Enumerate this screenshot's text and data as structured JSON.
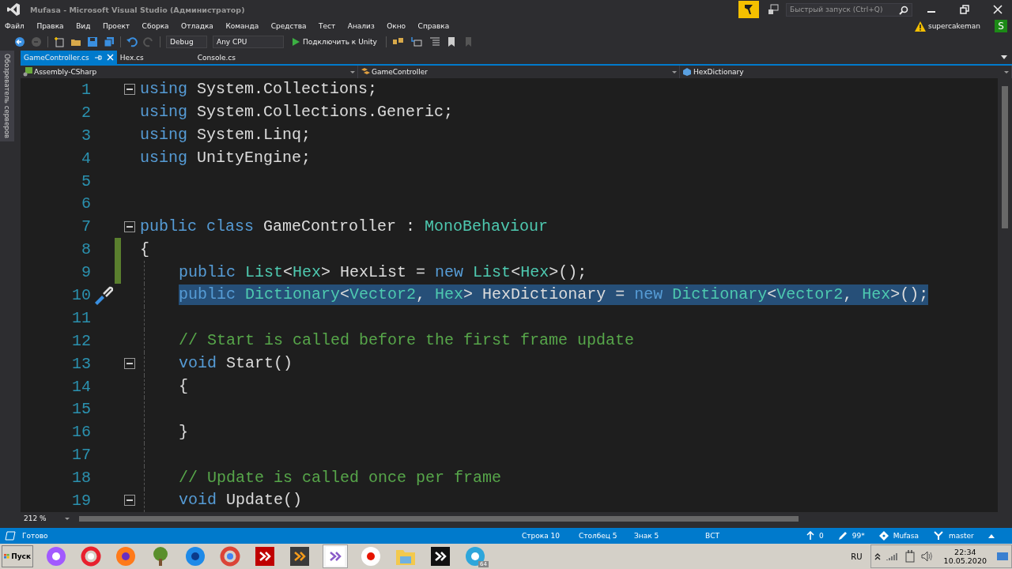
{
  "window": {
    "title": "Mufasa - Microsoft Visual Studio (Администратор)",
    "quick_launch": {
      "placeholder": "Быстрый запуск (Ctrl+Q)"
    },
    "user": "supercakeman",
    "avatar": "S"
  },
  "menu": [
    "Файл",
    "Правка",
    "Вид",
    "Проект",
    "Сборка",
    "Отладка",
    "Команда",
    "Средства",
    "Тест",
    "Анализ",
    "Окно",
    "Справка"
  ],
  "toolbar": {
    "configuration": "Debug",
    "platform": "Any CPU",
    "run_label": "Подключить к Unity"
  },
  "side_tab": "Обозреватель серверов",
  "tabs": [
    {
      "label": "GameController.cs",
      "selected": true
    },
    {
      "label": "Hex.cs",
      "selected": false
    },
    {
      "label": "Console.cs",
      "selected": false
    }
  ],
  "navigation": {
    "project": "Assembly-CSharp",
    "type": "GameController",
    "member": "HexDictionary"
  },
  "editor": {
    "zoom": "212 %",
    "lines": [
      {
        "number": "1",
        "fold": true,
        "indented": false,
        "changed": false,
        "selected": false,
        "quick_action": false,
        "tokens": [
          {
            "kind": "kw",
            "text": "using"
          },
          {
            "kind": "plain",
            "text": " System.Collections;"
          }
        ]
      },
      {
        "number": "2",
        "fold": false,
        "indented": false,
        "changed": false,
        "selected": false,
        "quick_action": false,
        "tokens": [
          {
            "kind": "kw",
            "text": "using"
          },
          {
            "kind": "plain",
            "text": " System.Collections.Generic;"
          }
        ]
      },
      {
        "number": "3",
        "fold": false,
        "indented": false,
        "changed": false,
        "selected": false,
        "quick_action": false,
        "tokens": [
          {
            "kind": "kw",
            "text": "using"
          },
          {
            "kind": "plain",
            "text": " System.Linq;"
          }
        ]
      },
      {
        "number": "4",
        "fold": false,
        "indented": false,
        "changed": false,
        "selected": false,
        "quick_action": false,
        "tokens": [
          {
            "kind": "kw",
            "text": "using"
          },
          {
            "kind": "plain",
            "text": " UnityEngine;"
          }
        ]
      },
      {
        "number": "5",
        "fold": false,
        "indented": false,
        "changed": false,
        "selected": false,
        "quick_action": false
      },
      {
        "number": "6",
        "fold": false,
        "indented": false,
        "changed": false,
        "selected": false,
        "quick_action": false
      },
      {
        "number": "7",
        "fold": true,
        "indented": false,
        "changed": false,
        "selected": false,
        "quick_action": false,
        "tokens": [
          {
            "kind": "kw",
            "text": "public class"
          },
          {
            "kind": "plain",
            "text": " GameController : "
          },
          {
            "kind": "type",
            "text": "MonoBehaviour"
          }
        ]
      },
      {
        "number": "8",
        "fold": false,
        "indented": false,
        "changed": true,
        "selected": false,
        "quick_action": false,
        "tokens": [
          {
            "kind": "plain",
            "text": "{"
          }
        ]
      },
      {
        "number": "9",
        "fold": false,
        "indented": true,
        "changed": true,
        "selected": false,
        "quick_action": false,
        "tokens": [
          {
            "kind": "kw",
            "text": "public "
          },
          {
            "kind": "type",
            "text": "List"
          },
          {
            "kind": "plain",
            "text": "<"
          },
          {
            "kind": "type",
            "text": "Hex"
          },
          {
            "kind": "plain",
            "text": "> HexList = "
          },
          {
            "kind": "kw",
            "text": "new "
          },
          {
            "kind": "type",
            "text": "List"
          },
          {
            "kind": "plain",
            "text": "<"
          },
          {
            "kind": "type",
            "text": "Hex"
          },
          {
            "kind": "plain",
            "text": ">();"
          }
        ]
      },
      {
        "number": "10",
        "fold": false,
        "indented": true,
        "changed": false,
        "selected": true,
        "quick_action": true,
        "tokens": [
          {
            "kind": "kw",
            "text": "public "
          },
          {
            "kind": "type",
            "text": "Dictionary"
          },
          {
            "kind": "plain",
            "text": "<"
          },
          {
            "kind": "type",
            "text": "Vector2"
          },
          {
            "kind": "plain",
            "text": ", "
          },
          {
            "kind": "type",
            "text": "Hex"
          },
          {
            "kind": "plain",
            "text": "> HexDictionary = "
          },
          {
            "kind": "kw",
            "text": "new "
          },
          {
            "kind": "type",
            "text": "Dictionary"
          },
          {
            "kind": "plain",
            "text": "<"
          },
          {
            "kind": "type",
            "text": "Vector2"
          },
          {
            "kind": "plain",
            "text": ", "
          },
          {
            "kind": "type",
            "text": "Hex"
          },
          {
            "kind": "plain",
            "text": ">();"
          }
        ]
      },
      {
        "number": "11",
        "fold": false,
        "indented": true,
        "changed": false,
        "selected": false,
        "quick_action": false
      },
      {
        "number": "12",
        "fold": false,
        "indented": true,
        "changed": false,
        "selected": false,
        "quick_action": false,
        "tokens": [
          {
            "kind": "comment",
            "text": "// Start is called before the first frame update"
          }
        ]
      },
      {
        "number": "13",
        "fold": true,
        "indented": true,
        "changed": false,
        "selected": false,
        "quick_action": false,
        "tokens": [
          {
            "kind": "kw",
            "text": "void "
          },
          {
            "kind": "plain",
            "text": "Start()"
          }
        ]
      },
      {
        "number": "14",
        "fold": false,
        "indented": true,
        "changed": false,
        "selected": false,
        "quick_action": false,
        "tokens": [
          {
            "kind": "plain",
            "text": "{"
          }
        ]
      },
      {
        "number": "15",
        "fold": false,
        "indented": true,
        "changed": false,
        "selected": false,
        "quick_action": false
      },
      {
        "number": "16",
        "fold": false,
        "indented": true,
        "changed": false,
        "selected": false,
        "quick_action": false,
        "tokens": [
          {
            "kind": "plain",
            "text": "}"
          }
        ]
      },
      {
        "number": "17",
        "fold": false,
        "indented": true,
        "changed": false,
        "selected": false,
        "quick_action": false
      },
      {
        "number": "18",
        "fold": false,
        "indented": true,
        "changed": false,
        "selected": false,
        "quick_action": false,
        "tokens": [
          {
            "kind": "comment",
            "text": "// Update is called once per frame"
          }
        ]
      },
      {
        "number": "19",
        "fold": true,
        "indented": true,
        "changed": false,
        "selected": false,
        "quick_action": false,
        "tokens": [
          {
            "kind": "kw",
            "text": "void "
          },
          {
            "kind": "plain",
            "text": "Update()"
          }
        ]
      }
    ]
  },
  "status_bar": {
    "state": "Готово",
    "line": "Строка 10",
    "column": "Столбец 5",
    "char": "Знак 5",
    "mode": "ВСТ",
    "push_count": "0",
    "changes": "99*",
    "repository": "Mufasa",
    "branch": "master"
  },
  "taskbar": {
    "start": "Пуск",
    "apps": [
      {
        "kind": "alice",
        "selected": false
      },
      {
        "kind": "opera",
        "selected": false
      },
      {
        "kind": "firefox",
        "selected": false
      },
      {
        "kind": "tree",
        "selected": false
      },
      {
        "kind": "firefox-dev",
        "selected": false
      },
      {
        "kind": "chrome",
        "selected": false
      },
      {
        "kind": "filezilla",
        "selected": false
      },
      {
        "kind": "sublime",
        "selected": false
      },
      {
        "kind": "visualstudio",
        "selected": true
      },
      {
        "kind": "yandex",
        "selected": false
      },
      {
        "kind": "explorer",
        "selected": false
      },
      {
        "kind": "unity",
        "selected": false
      },
      {
        "kind": "telegram",
        "selected": false,
        "badge": "64"
      }
    ],
    "language": "RU",
    "time": "22:34",
    "date": "10.05.2020"
  }
}
